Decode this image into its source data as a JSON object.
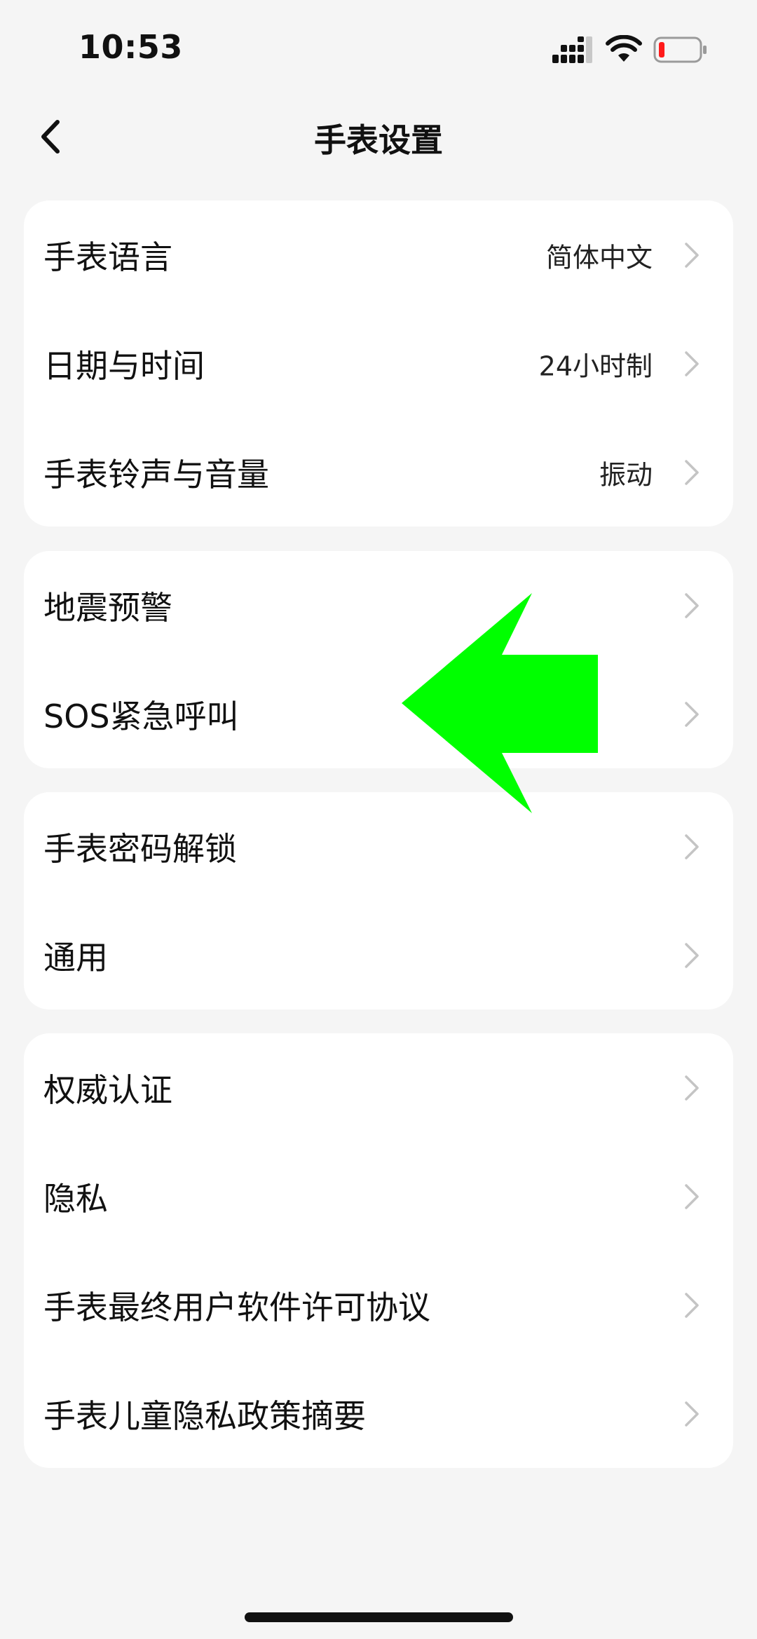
{
  "status_bar": {
    "time": "10:53"
  },
  "header": {
    "title": "手表设置",
    "back_icon": "chevron-left-icon"
  },
  "groups": [
    {
      "rows": [
        {
          "label": "手表语言",
          "value": "简体中文"
        },
        {
          "label": "日期与时间",
          "value": "24小时制"
        },
        {
          "label": "手表铃声与音量",
          "value": "振动"
        }
      ]
    },
    {
      "rows": [
        {
          "label": "地震预警",
          "value": ""
        },
        {
          "label": "SOS紧急呼叫",
          "value": ""
        }
      ]
    },
    {
      "rows": [
        {
          "label": "手表密码解锁",
          "value": ""
        },
        {
          "label": "通用",
          "value": ""
        }
      ]
    },
    {
      "rows": [
        {
          "label": "权威认证",
          "value": ""
        },
        {
          "label": "隐私",
          "value": ""
        },
        {
          "label": "手表最终用户软件许可协议",
          "value": ""
        },
        {
          "label": "手表儿童隐私政策摘要",
          "value": ""
        }
      ]
    }
  ],
  "colors": {
    "background": "#f5f5f5",
    "card": "#ffffff",
    "annotation_arrow": "#00ff00",
    "battery_low": "#ff1a1a"
  }
}
